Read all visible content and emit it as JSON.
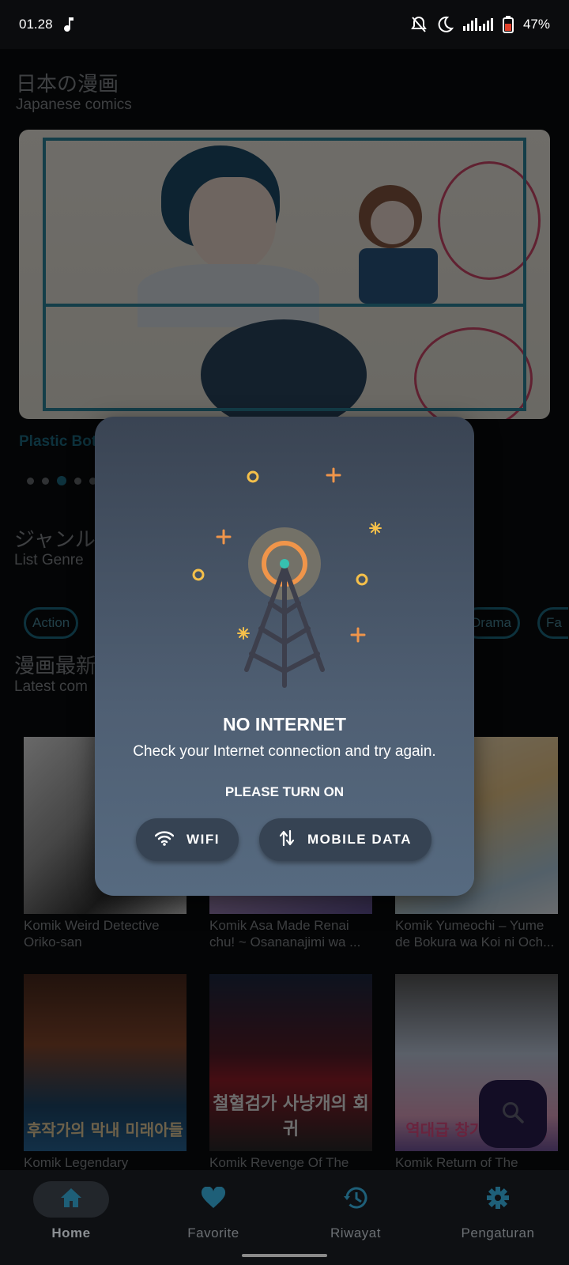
{
  "status_bar": {
    "time": "01.28",
    "battery": "47%",
    "icons": [
      "music-note-icon",
      "bell-off-icon",
      "moon-icon",
      "signal-icon",
      "battery-icon"
    ]
  },
  "home": {
    "header_jp": "日本の漫画",
    "header_en": "Japanese comics",
    "banner_title": "Plastic Bot",
    "carousel_pages": 5,
    "carousel_active": 3,
    "genre_jp": "ジャンル",
    "genre_en": "List Genre",
    "genres": [
      "Action",
      "Drama",
      "Fa"
    ],
    "latest_jp": "漫画最新",
    "latest_en": "Latest com",
    "comics": [
      {
        "title": "Komik Weird Detective Oriko-san"
      },
      {
        "title": "Komik Asa Made Renai chu! ~ Osananajimi wa ..."
      },
      {
        "title": "Komik Yumeochi – Yume de Bokura wa Koi ni Och..."
      },
      {
        "title": "Komik Legendary"
      },
      {
        "title": "Komik Revenge Of The"
      },
      {
        "title": "Komik Return of The"
      }
    ],
    "cover_texts": [
      "후작가의 막내 미래아들",
      "철혈검가 사냥개의 회귀",
      "역대급 창기사의 회귀"
    ]
  },
  "fab": {
    "icon": "search-icon"
  },
  "bottom_nav": [
    {
      "label": "Home",
      "icon": "home-icon",
      "active": true
    },
    {
      "label": "Favorite",
      "icon": "heart-icon",
      "active": false
    },
    {
      "label": "Riwayat",
      "icon": "history-icon",
      "active": false
    },
    {
      "label": "Pengaturan",
      "icon": "gear-icon",
      "active": false
    }
  ],
  "dialog": {
    "title": "NO INTERNET",
    "message": "Check your Internet connection and try again.",
    "cta": "PLEASE TURN ON",
    "wifi_label": "WIFI",
    "mobile_data_label": "MOBILE DATA"
  },
  "colors": {
    "accent": "#1e6f88",
    "dialog_top": "#3a4453",
    "dialog_bottom": "#566a80",
    "button_bg": "#364353",
    "antenna_orange": "#f0954a",
    "sparkle_yellow": "#f5c04a"
  }
}
